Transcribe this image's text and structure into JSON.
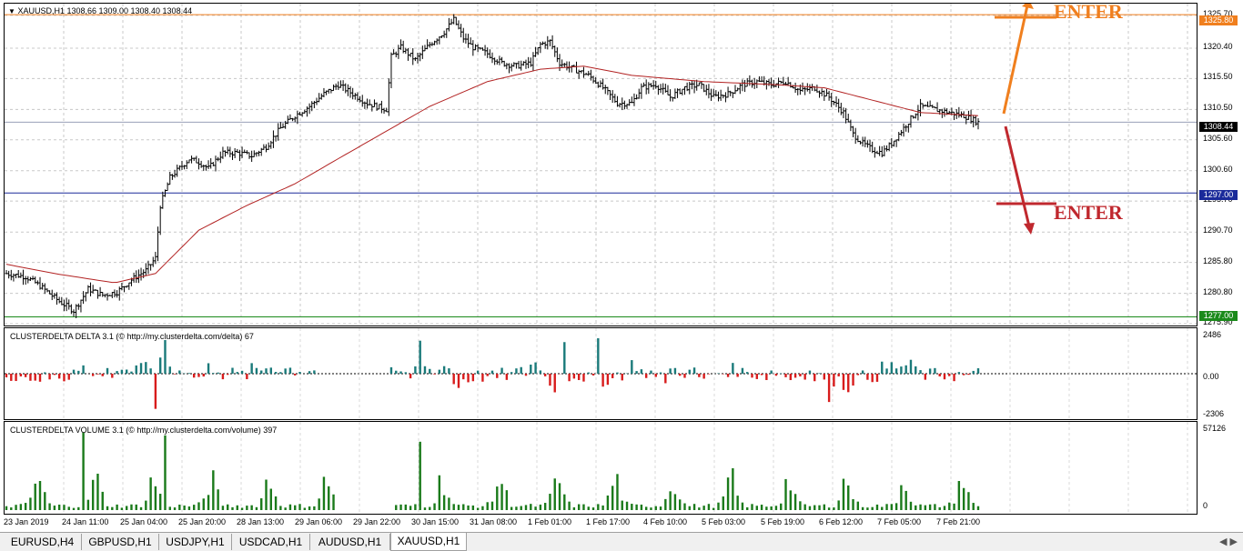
{
  "chart": {
    "header": "XAUUSD,H1  1308,66 1309.00 1308.40 1308.44",
    "price_ticks": [
      "1325.70",
      "1320.40",
      "1315.50",
      "1310.50",
      "1305.60",
      "1300.60",
      "1295.70",
      "1290.70",
      "1285.80",
      "1280.80",
      "1275.90"
    ],
    "levels": {
      "resistance": "1325.80",
      "support": "1297.00",
      "low": "1277.00",
      "current": "1308.44"
    },
    "level_colors": {
      "resistance": "#f07f1e",
      "support": "#1a2a9a",
      "low": "#1a8a1a",
      "current": "#000000"
    },
    "annotations": {
      "up_label": "ENTER",
      "down_label": "ENTER"
    },
    "annotation_colors": {
      "up": "#f07f1e",
      "down": "#c0282e"
    },
    "moving_average_color": "#b22222"
  },
  "delta": {
    "title": "CLUSTERDELTA DELTA 3.1 (© http://my.clusterdelta.com/delta) 67",
    "ticks": [
      "2486",
      "0.00",
      "-2306"
    ],
    "colors": {
      "positive": "#1a7a7a",
      "negative": "#d81c1c"
    }
  },
  "volume": {
    "title": "CLUSTERDELTA VOLUME 3.1 (© http://my.clusterdelta.com/volume) 397",
    "ticks": [
      "57126",
      "0"
    ],
    "color": "#1a7a1a"
  },
  "time_axis": [
    "23 Jan 2019",
    "24 Jan 11:00",
    "25 Jan 04:00",
    "25 Jan 20:00",
    "28 Jan 13:00",
    "29 Jan 06:00",
    "29 Jan 22:00",
    "30 Jan 15:00",
    "31 Jan 08:00",
    "1 Feb 01:00",
    "1 Feb 17:00",
    "4 Feb 10:00",
    "5 Feb 03:00",
    "5 Feb 19:00",
    "6 Feb 12:00",
    "7 Feb 05:00",
    "7 Feb 21:00"
  ],
  "tabs": [
    {
      "label": "EURUSD,H4"
    },
    {
      "label": "GBPUSD,H1"
    },
    {
      "label": "USDJPY,H1"
    },
    {
      "label": "USDCAD,H1"
    },
    {
      "label": "AUDUSD,H1"
    },
    {
      "label": "XAUUSD,H1",
      "active": true
    }
  ],
  "icons": {
    "menu": "triangle-down-icon",
    "scroll_left": "arrow-left-icon",
    "scroll_right": "arrow-right-icon"
  },
  "chart_data": {
    "type": "candlestick",
    "title": "XAUUSD,H1",
    "ylim": [
      1275.9,
      1327.0
    ],
    "grid": true,
    "close_path": [
      [
        0,
        1284.0
      ],
      [
        8,
        1283.5
      ],
      [
        14,
        1282.0
      ],
      [
        22,
        1279.5
      ],
      [
        28,
        1278.0
      ],
      [
        34,
        1281.5
      ],
      [
        40,
        1280.5
      ],
      [
        46,
        1281.0
      ],
      [
        52,
        1283.0
      ],
      [
        58,
        1284.5
      ],
      [
        62,
        1286.5
      ],
      [
        64,
        1295.0
      ],
      [
        68,
        1299.5
      ],
      [
        72,
        1301.0
      ],
      [
        76,
        1302.5
      ],
      [
        80,
        1302.0
      ],
      [
        84,
        1301.0
      ],
      [
        90,
        1303.5
      ],
      [
        96,
        1303.5
      ],
      [
        102,
        1303.0
      ],
      [
        108,
        1304.5
      ],
      [
        114,
        1307.5
      ],
      [
        120,
        1309.5
      ],
      [
        126,
        1311.0
      ],
      [
        132,
        1313.0
      ],
      [
        138,
        1314.5
      ],
      [
        144,
        1313.0
      ],
      [
        150,
        1311.5
      ],
      [
        158,
        1310.5
      ],
      [
        160,
        1319.0
      ],
      [
        164,
        1320.5
      ],
      [
        170,
        1318.5
      ],
      [
        176,
        1321.0
      ],
      [
        182,
        1323.0
      ],
      [
        186,
        1325.0
      ],
      [
        190,
        1322.0
      ],
      [
        194,
        1320.5
      ],
      [
        200,
        1319.5
      ],
      [
        206,
        1318.0
      ],
      [
        212,
        1317.5
      ],
      [
        218,
        1318.0
      ],
      [
        222,
        1321.0
      ],
      [
        226,
        1321.5
      ],
      [
        230,
        1318.0
      ],
      [
        236,
        1317.0
      ],
      [
        242,
        1316.0
      ],
      [
        248,
        1314.0
      ],
      [
        254,
        1311.5
      ],
      [
        260,
        1311.5
      ],
      [
        264,
        1314.0
      ],
      [
        270,
        1314.5
      ],
      [
        276,
        1312.5
      ],
      [
        282,
        1314.0
      ],
      [
        288,
        1314.5
      ],
      [
        294,
        1312.5
      ],
      [
        300,
        1313.0
      ],
      [
        306,
        1314.5
      ],
      [
        312,
        1315.0
      ],
      [
        318,
        1314.5
      ],
      [
        324,
        1315.0
      ],
      [
        330,
        1313.5
      ],
      [
        336,
        1314.0
      ],
      [
        342,
        1312.5
      ],
      [
        348,
        1310.0
      ],
      [
        352,
        1306.5
      ],
      [
        356,
        1305.0
      ],
      [
        360,
        1304.0
      ],
      [
        364,
        1303.5
      ],
      [
        368,
        1305.0
      ],
      [
        374,
        1308.0
      ],
      [
        380,
        1311.0
      ],
      [
        386,
        1310.5
      ],
      [
        392,
        1310.0
      ],
      [
        398,
        1309.5
      ],
      [
        404,
        1308.44
      ]
    ],
    "moving_average": [
      [
        0,
        1285.5
      ],
      [
        20,
        1284.0
      ],
      [
        45,
        1282.5
      ],
      [
        62,
        1284.0
      ],
      [
        80,
        1291.0
      ],
      [
        100,
        1295.0
      ],
      [
        120,
        1298.5
      ],
      [
        140,
        1303.0
      ],
      [
        158,
        1307.0
      ],
      [
        176,
        1311.0
      ],
      [
        200,
        1315.0
      ],
      [
        222,
        1317.0
      ],
      [
        240,
        1317.5
      ],
      [
        260,
        1316.0
      ],
      [
        290,
        1315.0
      ],
      [
        320,
        1314.5
      ],
      [
        340,
        1314.0
      ],
      [
        360,
        1312.0
      ],
      [
        380,
        1310.0
      ],
      [
        404,
        1309.5
      ]
    ],
    "horizontal_levels": [
      1325.8,
      1297.0,
      1277.0
    ],
    "delta_peak": 2486,
    "delta_trough": -2306,
    "volume_peak": 57126
  }
}
